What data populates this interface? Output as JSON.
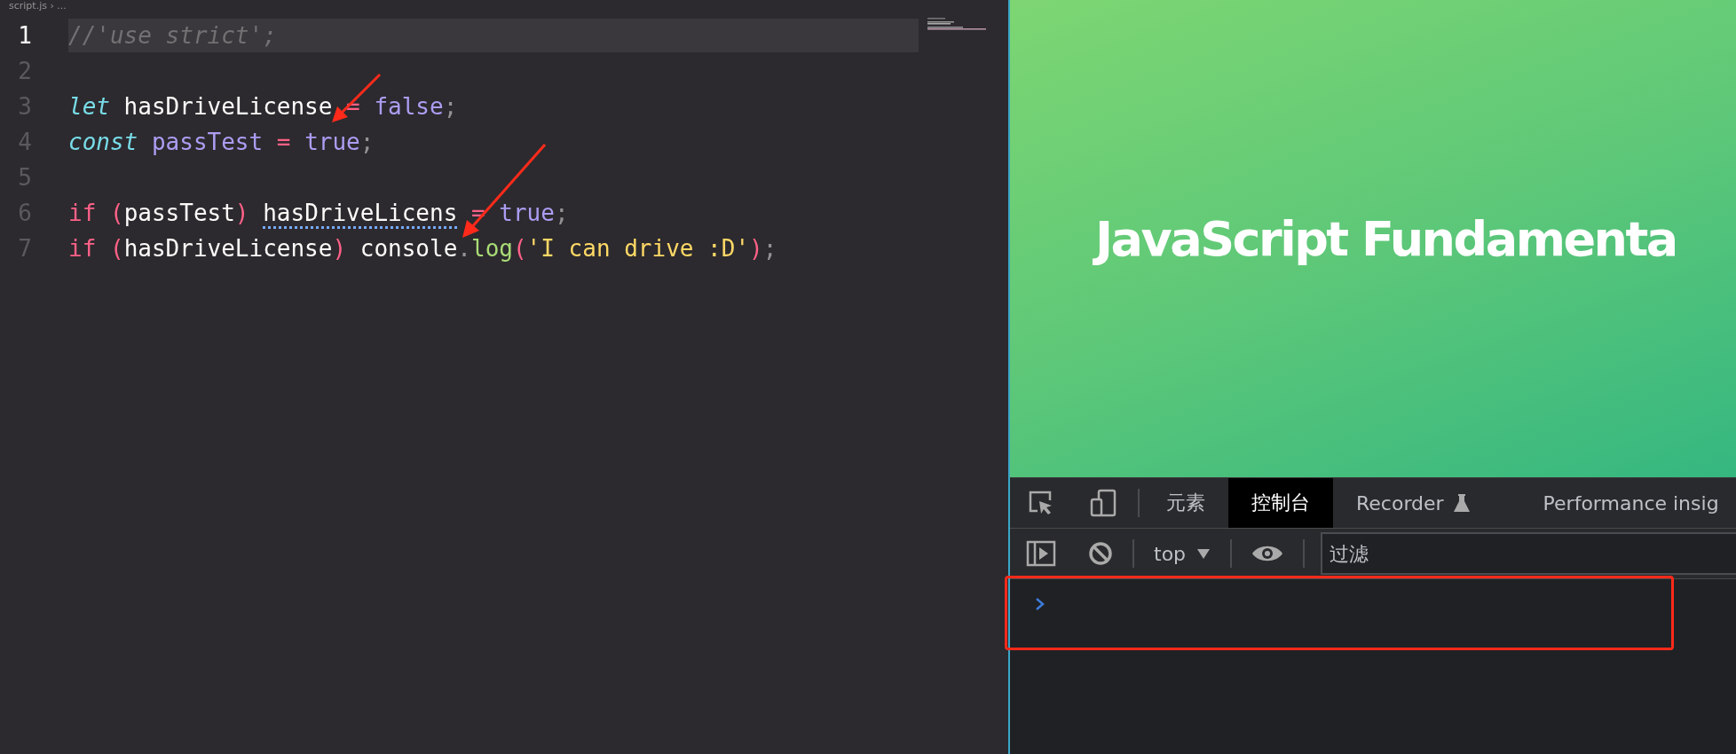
{
  "editor": {
    "breadcrumb": "script.js › ...",
    "lines": [
      {
        "number": "1",
        "current": true,
        "tokens": [
          {
            "text": "//'use strict';",
            "kind": "comment"
          }
        ]
      },
      {
        "number": "2",
        "current": false
      },
      {
        "number": "3",
        "current": false,
        "tokens": [
          {
            "text": "let",
            "kind": "storage"
          },
          {
            "text": " hasDriveLicense",
            "kind": "plain"
          },
          {
            "text": " = ",
            "kind": "op"
          },
          {
            "text": "false",
            "kind": "const"
          },
          {
            "text": ";",
            "kind": "punct"
          }
        ]
      },
      {
        "number": "4",
        "current": false,
        "tokens": [
          {
            "text": "const",
            "kind": "storage"
          },
          {
            "text": " passTest",
            "kind": "const"
          },
          {
            "text": " = ",
            "kind": "op"
          },
          {
            "text": "true",
            "kind": "const"
          },
          {
            "text": ";",
            "kind": "punct"
          }
        ]
      },
      {
        "number": "5",
        "current": false
      },
      {
        "number": "6",
        "current": false,
        "tokens": [
          {
            "text": "if",
            "kind": "op"
          },
          {
            "text": " (",
            "kind": "op"
          },
          {
            "text": "passTest",
            "kind": "plain"
          },
          {
            "text": ") ",
            "kind": "op"
          },
          {
            "text": "hasDriveLicens",
            "kind": "plain",
            "hint": true
          },
          {
            "text": " = ",
            "kind": "op"
          },
          {
            "text": "true",
            "kind": "const"
          },
          {
            "text": ";",
            "kind": "punct"
          }
        ]
      },
      {
        "number": "7",
        "current": false,
        "tokens": [
          {
            "text": "if",
            "kind": "op"
          },
          {
            "text": " (",
            "kind": "op"
          },
          {
            "text": "hasDriveLicense",
            "kind": "plain"
          },
          {
            "text": ")",
            "kind": "op"
          },
          {
            "text": " console",
            "kind": "plain"
          },
          {
            "text": ".",
            "kind": "punct"
          },
          {
            "text": "log",
            "kind": "func"
          },
          {
            "text": "(",
            "kind": "op"
          },
          {
            "text": "'I can drive :D'",
            "kind": "string"
          },
          {
            "text": ")",
            "kind": "op"
          },
          {
            "text": ";",
            "kind": "punct"
          }
        ]
      }
    ]
  },
  "preview": {
    "heading": "JavaScript Fundamenta"
  },
  "devtools": {
    "tabs": [
      {
        "label": "元素",
        "selected": false,
        "kind": "plain"
      },
      {
        "label": "控制台",
        "selected": true,
        "kind": "plain"
      },
      {
        "label": "Recorder",
        "selected": false,
        "kind": "experiment"
      },
      {
        "label": "Performance insig",
        "selected": false,
        "kind": "plain"
      }
    ],
    "context": "top",
    "filter": {
      "placeholder": "过滤"
    }
  }
}
